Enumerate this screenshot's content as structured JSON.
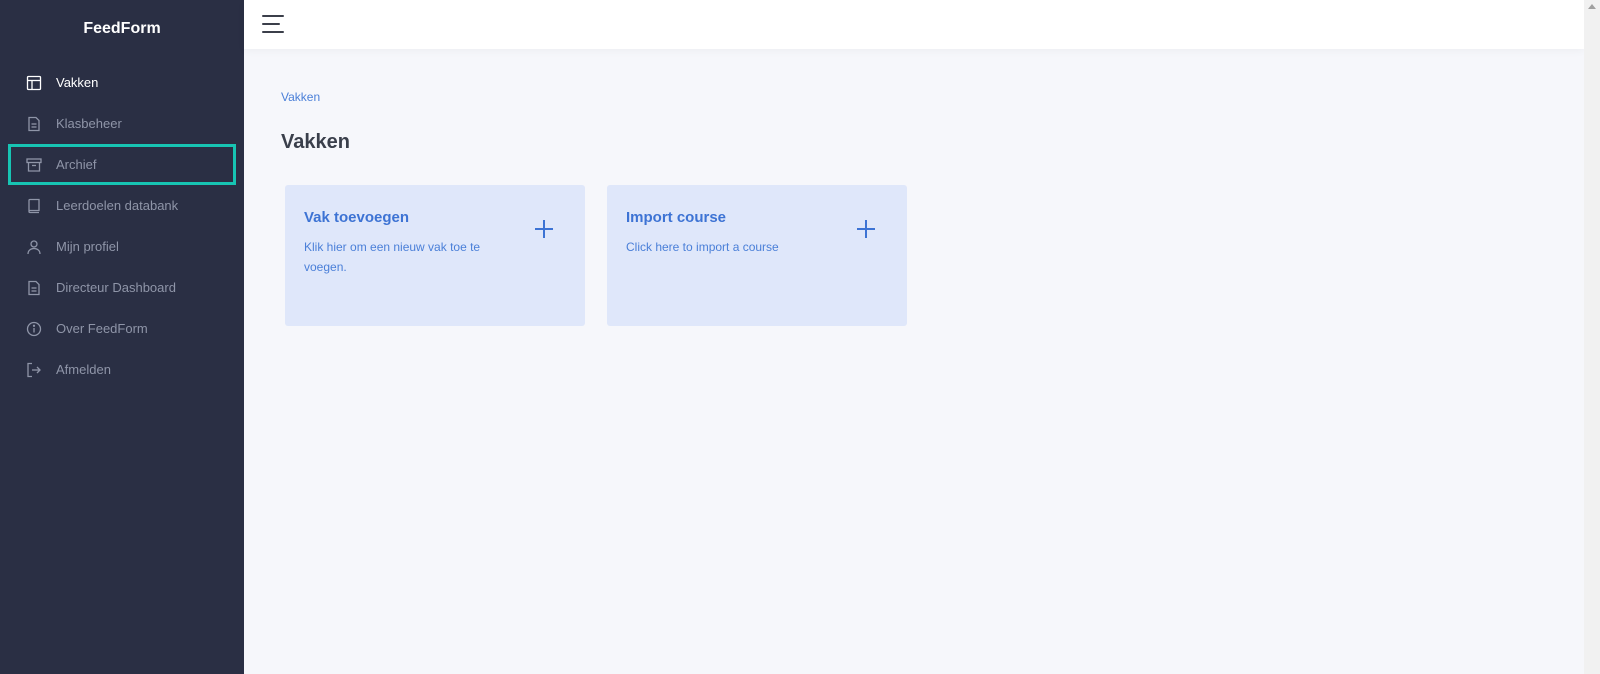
{
  "app": {
    "brand": "FeedForm"
  },
  "sidebar": {
    "items": [
      {
        "label": "Vakken",
        "icon": "layout-icon"
      },
      {
        "label": "Klasbeheer",
        "icon": "document-icon"
      },
      {
        "label": "Archief",
        "icon": "archive-icon"
      },
      {
        "label": "Leerdoelen databank",
        "icon": "book-icon"
      },
      {
        "label": "Mijn profiel",
        "icon": "user-icon"
      },
      {
        "label": "Directeur Dashboard",
        "icon": "document-icon"
      },
      {
        "label": "Over FeedForm",
        "icon": "info-icon"
      },
      {
        "label": "Afmelden",
        "icon": "logout-icon"
      }
    ]
  },
  "main": {
    "breadcrumb": "Vakken",
    "title": "Vakken",
    "cards": [
      {
        "title": "Vak toevoegen",
        "description": "Klik hier om een nieuw vak toe te voegen."
      },
      {
        "title": "Import course",
        "description": "Click here to import a course"
      }
    ]
  },
  "colors": {
    "sidebar_bg": "#2a2f44",
    "accent": "#3d73d4",
    "highlight": "#17c4b3",
    "card_bg": "#dfe7fa"
  }
}
